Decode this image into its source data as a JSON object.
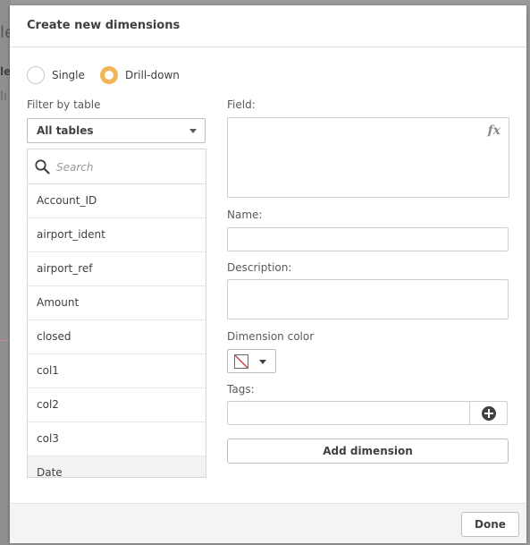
{
  "background": {
    "letter_top": "le",
    "letter_mid": "le",
    "letter_small": "lı"
  },
  "dialog": {
    "title": "Create new dimensions",
    "mode": {
      "options": [
        "Single",
        "Drill-down"
      ],
      "selected": "Drill-down"
    },
    "filter": {
      "label": "Filter by table",
      "selected": "All tables"
    },
    "search": {
      "placeholder": "Search",
      "value": ""
    },
    "fields": [
      "Account_ID",
      "airport_ident",
      "airport_ref",
      "Amount",
      "closed",
      "col1",
      "col2",
      "col3",
      "Date"
    ],
    "form": {
      "field_label": "Field:",
      "field_value": "",
      "fx_label": "fx",
      "name_label": "Name:",
      "name_value": "",
      "description_label": "Description:",
      "description_value": "",
      "color_label": "Dimension color",
      "tags_label": "Tags:",
      "tags_value": "",
      "add_dimension_label": "Add dimension"
    },
    "footer": {
      "done_label": "Done"
    }
  },
  "colors": {
    "accent": "#f3b55a",
    "text": "#404040",
    "border": "#cfcfcf",
    "swatch_slash": "#d23a3a"
  }
}
